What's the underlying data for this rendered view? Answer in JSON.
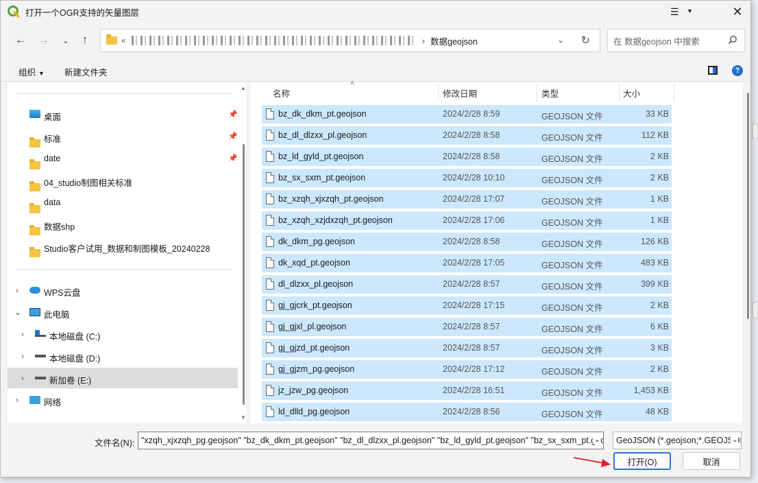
{
  "window": {
    "title": "打开一个OGR支持的矢量图层",
    "close_glyph": "✕"
  },
  "address": {
    "prefix": "«",
    "current_folder": "数据geojson"
  },
  "search": {
    "placeholder": "在 数据geojson 中搜索"
  },
  "toolbar": {
    "organize": "组织",
    "new_folder": "新建文件夹"
  },
  "nav": {
    "quick_access": [
      {
        "label": "桌面",
        "icon": "desktop-icon",
        "pinned": true
      },
      {
        "label": "标准",
        "icon": "folder-icon",
        "pinned": true
      },
      {
        "label": "date",
        "icon": "folder-icon",
        "pinned": true
      },
      {
        "label": "04_studio制图相关标准",
        "icon": "folder-icon",
        "pinned": false
      },
      {
        "label": "data",
        "icon": "folder-icon",
        "pinned": false
      },
      {
        "label": "数据shp",
        "icon": "folder-icon",
        "pinned": false
      },
      {
        "label": "Studio客户试用_数据和制图模板_20240228",
        "icon": "folder-icon",
        "pinned": false
      }
    ],
    "wps_cloud": "WPS云盘",
    "this_pc": "此电脑",
    "drives": [
      {
        "label": "本地磁盘 (C:)",
        "icon": "windows-drive-icon"
      },
      {
        "label": "本地磁盘 (D:)",
        "icon": "drive-icon"
      },
      {
        "label": "新加卷 (E:)",
        "icon": "drive-icon",
        "selected": true
      }
    ],
    "network": "网络"
  },
  "columns": {
    "name": "名称",
    "date": "修改日期",
    "type": "类型",
    "size": "大小"
  },
  "files": [
    {
      "name": "bz_dk_dkm_pt.geojson",
      "date": "2024/2/28 8:59",
      "type": "GEOJSON 文件",
      "size": "33 KB"
    },
    {
      "name": "bz_dl_dlzxx_pl.geojson",
      "date": "2024/2/28 8:58",
      "type": "GEOJSON 文件",
      "size": "112 KB"
    },
    {
      "name": "bz_ld_gyld_pt.geojson",
      "date": "2024/2/28 8:58",
      "type": "GEOJSON 文件",
      "size": "2 KB"
    },
    {
      "name": "bz_sx_sxm_pt.geojson",
      "date": "2024/2/28 10:10",
      "type": "GEOJSON 文件",
      "size": "2 KB"
    },
    {
      "name": "bz_xzqh_xjxzqh_pt.geojson",
      "date": "2024/2/28 17:07",
      "type": "GEOJSON 文件",
      "size": "1 KB"
    },
    {
      "name": "bz_xzqh_xzjdxzqh_pt.geojson",
      "date": "2024/2/28 17:06",
      "type": "GEOJSON 文件",
      "size": "1 KB"
    },
    {
      "name": "dk_dkm_pg.geojson",
      "date": "2024/2/28 8:58",
      "type": "GEOJSON 文件",
      "size": "126 KB"
    },
    {
      "name": "dk_xqd_pt.geojson",
      "date": "2024/2/28 17:05",
      "type": "GEOJSON 文件",
      "size": "483 KB"
    },
    {
      "name": "dl_dlzxx_pl.geojson",
      "date": "2024/2/28 8:57",
      "type": "GEOJSON 文件",
      "size": "399 KB"
    },
    {
      "name": "gj_gjcrk_pt.geojson",
      "date": "2024/2/28 17:15",
      "type": "GEOJSON 文件",
      "size": "2 KB"
    },
    {
      "name": "gj_gjxl_pl.geojson",
      "date": "2024/2/28 8:57",
      "type": "GEOJSON 文件",
      "size": "6 KB"
    },
    {
      "name": "gj_gjzd_pt.geojson",
      "date": "2024/2/28 8:57",
      "type": "GEOJSON 文件",
      "size": "3 KB"
    },
    {
      "name": "gj_gjzm_pg.geojson",
      "date": "2024/2/28 17:12",
      "type": "GEOJSON 文件",
      "size": "2 KB"
    },
    {
      "name": "jz_jzw_pg.geojson",
      "date": "2024/2/28 16:51",
      "type": "GEOJSON 文件",
      "size": "1,453 KB"
    },
    {
      "name": "ld_dlld_pg.geojson",
      "date": "2024/2/28 8:56",
      "type": "GEOJSON 文件",
      "size": "48 KB"
    }
  ],
  "bottom": {
    "filename_label": "文件名(N):",
    "filename_value": "\"xzqh_xjxzqh_pg.geojson\" \"bz_dk_dkm_pt.geojson\" \"bz_dl_dlzxx_pl.geojson\" \"bz_ld_gyld_pt.geojson\" \"bz_sx_sxm_pt.geojson\"",
    "filter_value": "GeoJSON (*.geojson;*.GEOJSON)",
    "open_label": "打开(O)",
    "cancel_label": "取消"
  },
  "colors": {
    "selection": "#cce8ff",
    "accent": "#2a72d4",
    "annotation_arrow": "#e02020"
  }
}
